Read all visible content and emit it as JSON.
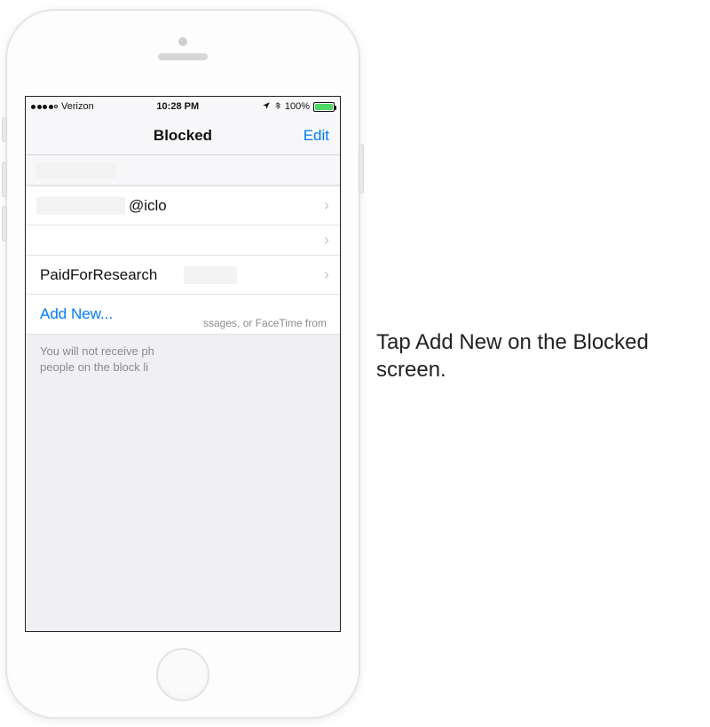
{
  "status": {
    "carrier": "Verizon",
    "time": "10:28 PM",
    "battery_pct": "100%",
    "location_icon": "location-arrow",
    "bluetooth_icon": "bluetooth"
  },
  "nav": {
    "title": "Blocked",
    "edit_label": "Edit"
  },
  "rows": [
    {
      "label": " ",
      "has_chevron": false
    },
    {
      "label": "@iclo",
      "has_chevron": true
    },
    {
      "label": "",
      "has_chevron": true
    },
    {
      "label": "PaidForResearch",
      "has_chevron": true
    }
  ],
  "add_new_label": "Add New...",
  "footer_fragment_right": "ssages, or FaceTime from",
  "footer_line1": "You will not receive ph",
  "footer_line2": "people on the block li",
  "instruction_text": "Tap Add New on the Blocked screen.",
  "colors": {
    "ios_blue": "#007aff",
    "ios_green": "#4cd964",
    "ios_gray_bg": "#efeff4"
  }
}
